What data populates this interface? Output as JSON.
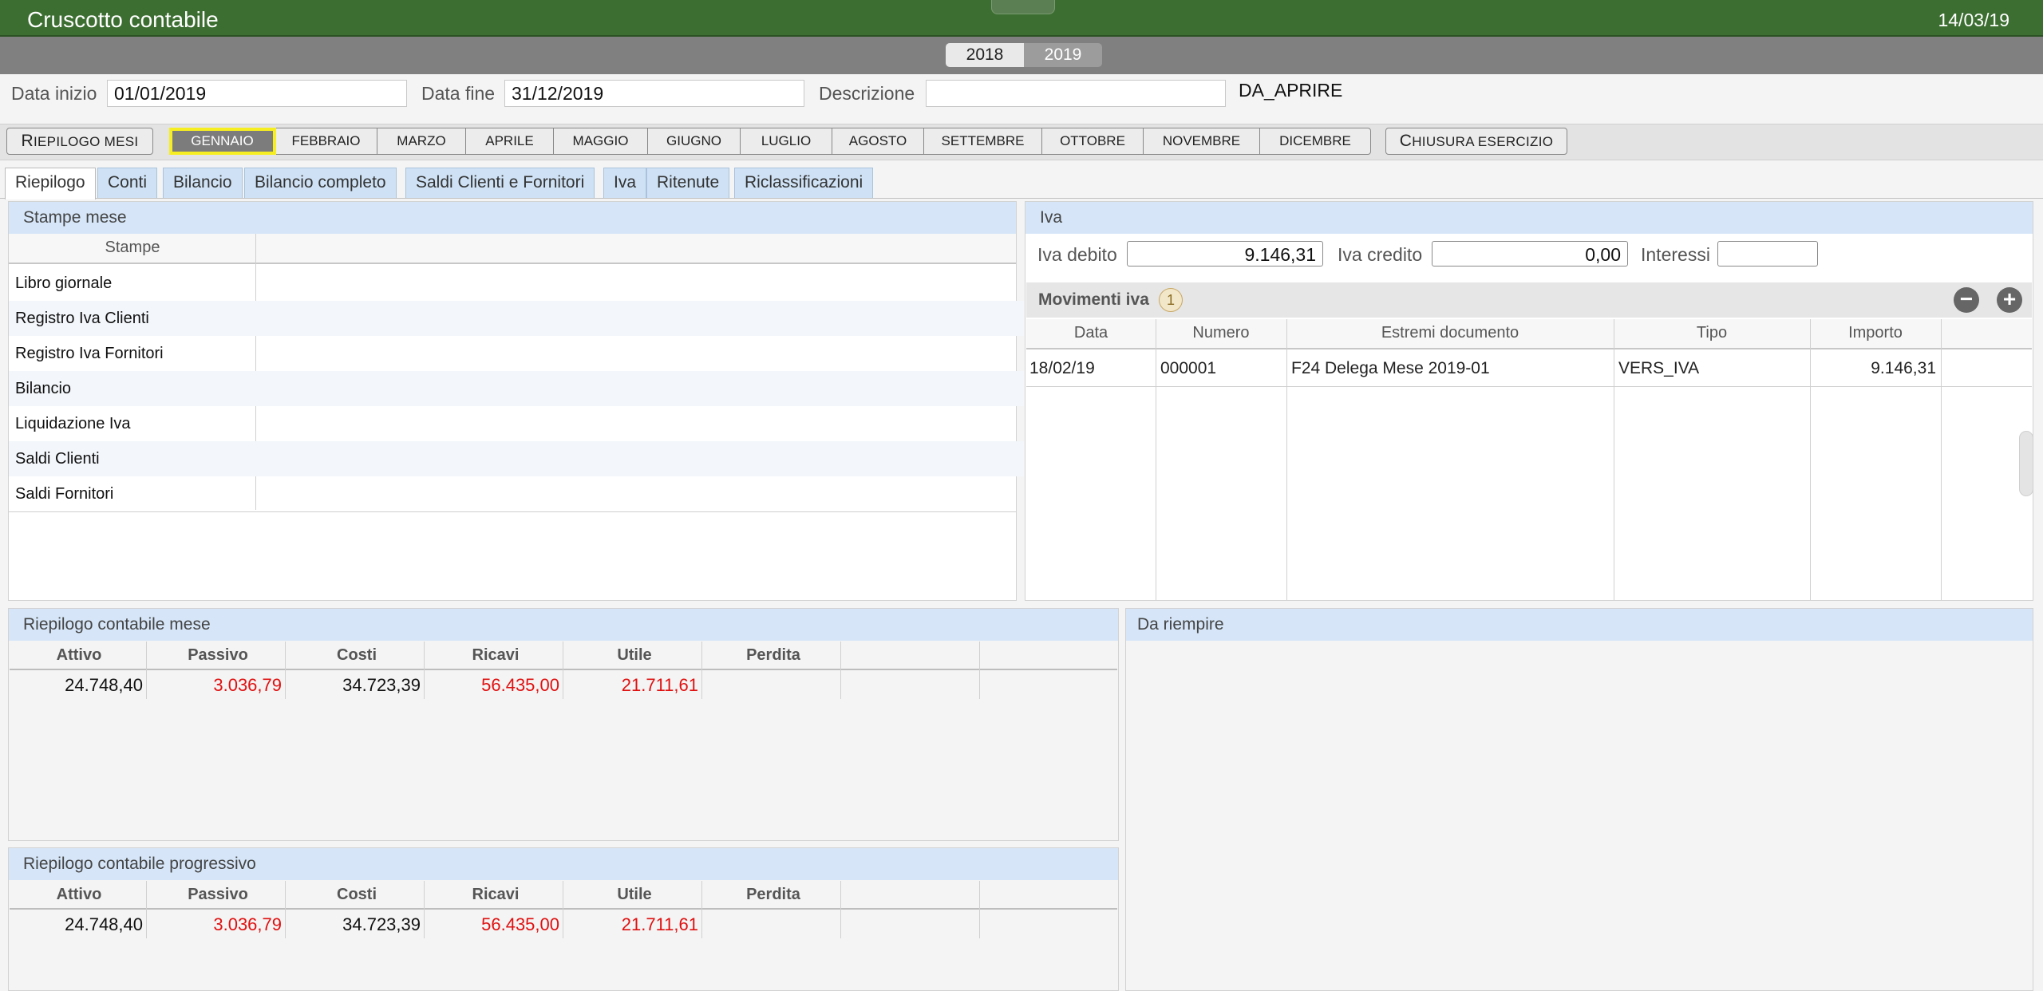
{
  "app": {
    "title": "Cruscotto contabile",
    "date": "14/03/19"
  },
  "years": [
    "2018",
    "2019"
  ],
  "selected_year": "2019",
  "filters": {
    "data_inizio_label": "Data inizio",
    "data_inizio": "01/01/2019",
    "data_fine_label": "Data fine",
    "data_fine": "31/12/2019",
    "descrizione_label": "Descrizione",
    "descrizione": "",
    "stato": "DA_APRIRE"
  },
  "months": {
    "riepilogo": "Riepilogo mesi",
    "items": [
      "Gennaio",
      "Febbraio",
      "Marzo",
      "Aprile",
      "Maggio",
      "Giugno",
      "Luglio",
      "Agosto",
      "Settembre",
      "Ottobre",
      "Novembre",
      "Dicembre"
    ],
    "active": "Gennaio",
    "chiusura": "Chiusura esercizio"
  },
  "tabs": [
    "Riepilogo",
    "Conti",
    "Bilancio",
    "Bilancio completo",
    "Saldi Clienti e Fornitori",
    "Iva",
    "Ritenute",
    "Riclassificazioni"
  ],
  "active_tab": "Riepilogo",
  "stampe": {
    "title": "Stampe mese",
    "column": "Stampe",
    "rows": [
      "Libro giornale",
      "Registro Iva Clienti",
      "Registro Iva Fornitori",
      "Bilancio",
      "Liquidazione Iva",
      "Saldi Clienti",
      "Saldi Fornitori"
    ]
  },
  "iva": {
    "title": "Iva",
    "debito_label": "Iva debito",
    "debito": "9.146,31",
    "credito_label": "Iva credito",
    "credito": "0,00",
    "interessi_label": "Interessi",
    "interessi": "",
    "movimenti_title": "Movimenti iva",
    "movimenti_count": "1",
    "columns": [
      "Data",
      "Numero",
      "Estremi documento",
      "Tipo",
      "Importo"
    ],
    "rows": [
      {
        "data": "18/02/19",
        "numero": "000001",
        "estremi": "F24 Delega Mese 2019-01",
        "tipo": "VERS_IVA",
        "importo": "9.146,31"
      }
    ]
  },
  "riepilogo_mese": {
    "title": "Riepilogo contabile mese",
    "columns": [
      "Attivo",
      "Passivo",
      "Costi",
      "Ricavi",
      "Utile",
      "Perdita"
    ],
    "values": [
      "24.748,40",
      "3.036,79",
      "34.723,39",
      "56.435,00",
      "21.711,61",
      ""
    ]
  },
  "riepilogo_progressivo": {
    "title": "Riepilogo contabile progressivo",
    "columns": [
      "Attivo",
      "Passivo",
      "Costi",
      "Ricavi",
      "Utile",
      "Perdita"
    ],
    "values": [
      "24.748,40",
      "3.036,79",
      "34.723,39",
      "56.435,00",
      "21.711,61",
      ""
    ]
  },
  "da_riempire": {
    "title": "Da riempire"
  },
  "colors": {
    "title_bar": "#3c6e31",
    "panel_header": "#d6e6f8",
    "negative": "#e01010",
    "highlight": "#f7ee22"
  }
}
